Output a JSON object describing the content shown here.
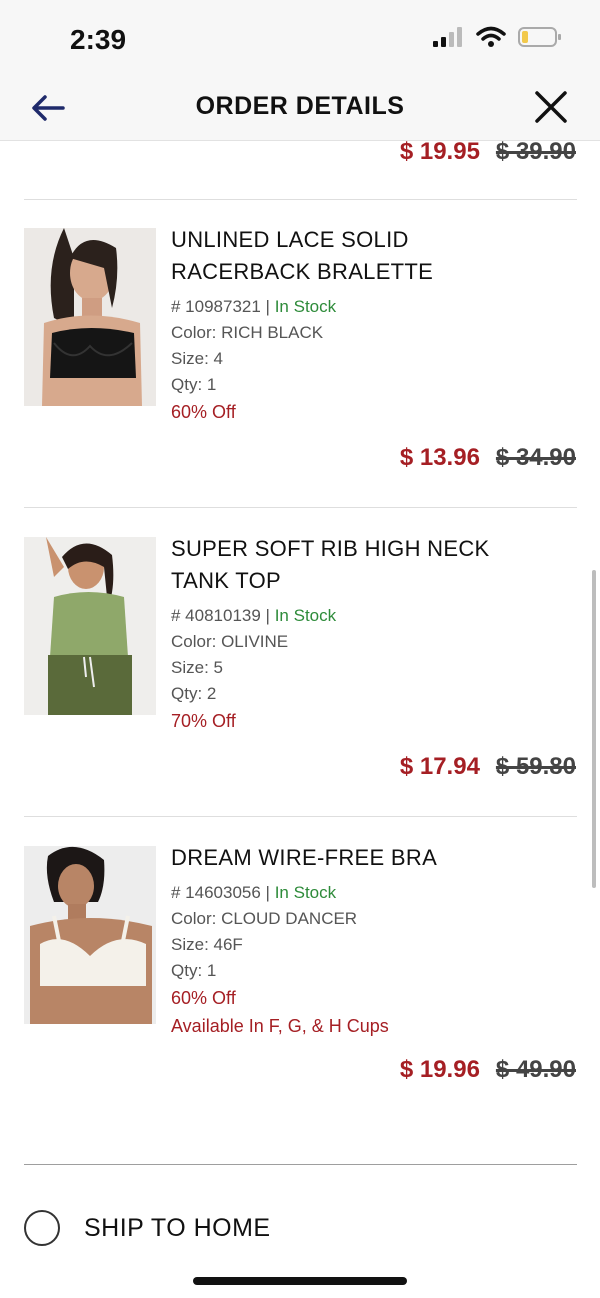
{
  "status_bar": {
    "time": "2:39"
  },
  "header": {
    "title": "ORDER DETAILS"
  },
  "top_item": {
    "sale_price": "$ 19.95",
    "original_price": "$ 39.90"
  },
  "items": [
    {
      "title_line1": "UNLINED LACE SOLID",
      "title_line2": "RACERBACK BRALETTE",
      "sku": "# 10987321 |",
      "stock": "In Stock",
      "color": "Color: RICH BLACK",
      "size": "Size: 4",
      "qty": "Qty: 1",
      "discount": "60% Off",
      "extra": "",
      "sale_price": "$ 13.96",
      "original_price": "$ 34.90"
    },
    {
      "title_line1": "SUPER SOFT RIB HIGH NECK",
      "title_line2": "TANK TOP",
      "sku": "# 40810139 |",
      "stock": "In Stock",
      "color": "Color: OLIVINE",
      "size": "Size: 5",
      "qty": "Qty: 2",
      "discount": "70% Off",
      "extra": "",
      "sale_price": "$ 17.94",
      "original_price": "$ 59.80"
    },
    {
      "title_line1": "DREAM WIRE-FREE BRA",
      "title_line2": "",
      "sku": "# 14603056 |",
      "stock": "In Stock",
      "color": "Color: CLOUD DANCER",
      "size": "Size: 46F",
      "qty": "Qty: 1",
      "discount": "60% Off",
      "extra": "Available In F, G, & H Cups",
      "sale_price": "$ 19.96",
      "original_price": "$ 49.90"
    }
  ],
  "shipping": {
    "label": "SHIP TO HOME"
  },
  "colors": {
    "sale": "#a51f24",
    "stock": "#2e8b3a",
    "header_bg": "#f7f7f7"
  }
}
